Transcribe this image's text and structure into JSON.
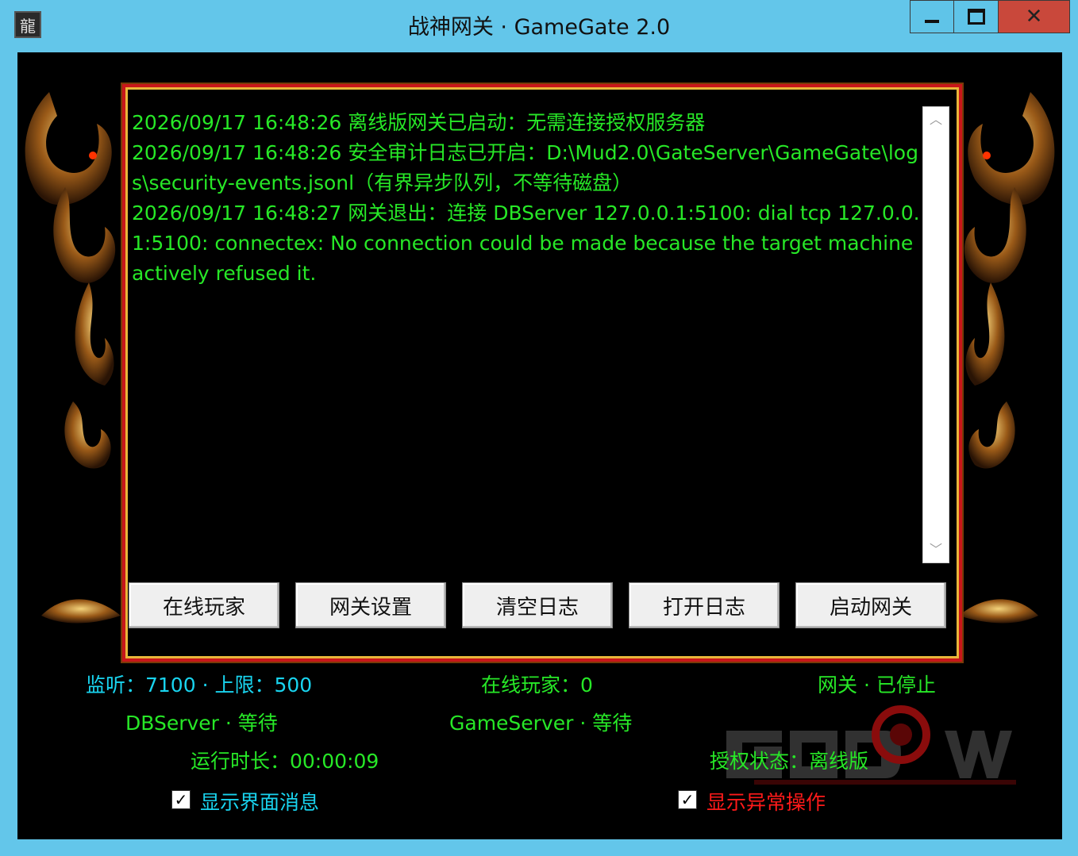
{
  "window": {
    "title": "战神网关 · GameGate 2.0",
    "icon_glyph": "龍",
    "close_glyph": "✕"
  },
  "log": {
    "lines": [
      "2026/09/17 16:48:26 离线版网关已启动：无需连接授权服务器",
      "2026/09/17 16:48:26 安全审计日志已开启：D:\\Mud2.0\\GateServer\\GameGate\\logs\\security-events.jsonl（有界异步队列，不等待磁盘）",
      "2026/09/17 16:48:27 网关退出：连接 DBServer 127.0.0.1:5100: dial tcp 127.0.0.1:5100: connectex: No connection could be made because the target machine actively refused it."
    ]
  },
  "buttons": {
    "online_players": "在线玩家",
    "gate_settings": "网关设置",
    "clear_log": "清空日志",
    "open_log": "打开日志",
    "start_gate": "启动网关"
  },
  "status": {
    "listen": "监听：7100 · 上限：500",
    "online": "在线玩家：0",
    "gate_state": "网关 · 已停止",
    "dbserver": "DBServer · 等待",
    "gameserver": "GameServer · 等待",
    "uptime": "运行时长：00:00:09",
    "license": "授权状态：离线版"
  },
  "options": {
    "show_ui_messages": {
      "label": "显示界面消息",
      "checked": true
    },
    "show_abnormal_ops": {
      "label": "显示异常操作",
      "checked": true
    }
  },
  "colors": {
    "title_bar": "#63c6ea",
    "log_text": "#27e827",
    "cyan_text": "#19d4ef",
    "red_text": "#ff1a1a",
    "frame_red": "#c8161a",
    "frame_gold": "#e9b63a"
  },
  "icons": {
    "app": "dragon-app-icon",
    "minimize": "minimize-icon",
    "maximize": "maximize-icon",
    "close": "close-icon",
    "scroll_up": "chevron-up-icon",
    "scroll_down": "chevron-down-icon",
    "checkbox": "checkmark-icon"
  }
}
